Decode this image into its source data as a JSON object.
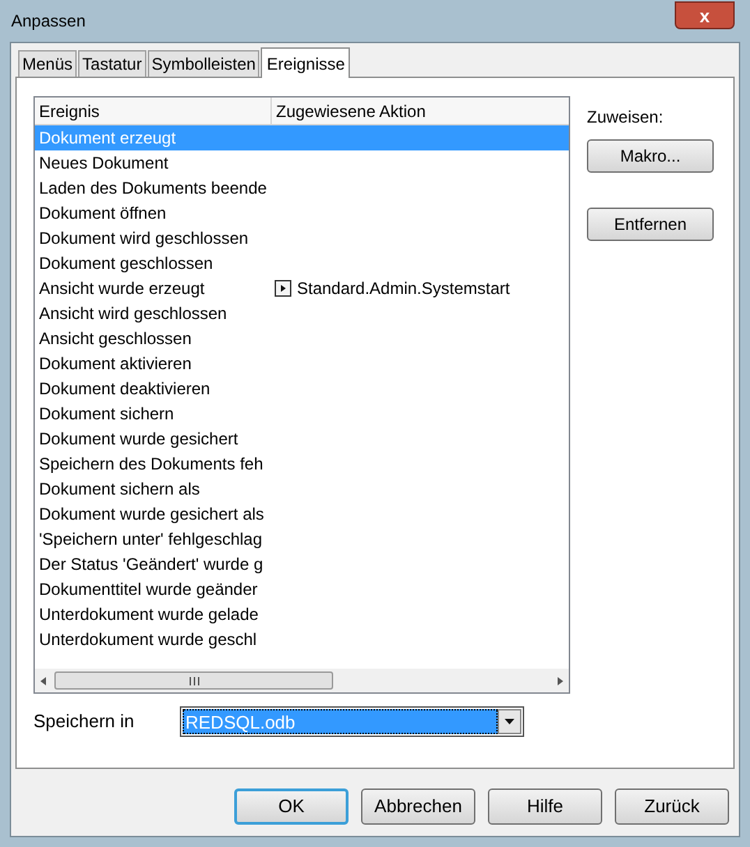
{
  "window": {
    "title": "Anpassen",
    "close_label": "x"
  },
  "tabs": [
    {
      "label": "Menüs",
      "selected": false
    },
    {
      "label": "Tastatur",
      "selected": false
    },
    {
      "label": "Symbolleisten",
      "selected": false
    },
    {
      "label": "Ereignisse",
      "selected": true
    }
  ],
  "table": {
    "columns": [
      "Ereignis",
      "Zugewiesene Aktion"
    ],
    "rows": [
      {
        "event": "Dokument erzeugt",
        "selected": true
      },
      {
        "event": "Neues Dokument",
        "selected": false
      },
      {
        "event": "Laden des Dokuments beende",
        "selected": false
      },
      {
        "event": "Dokument öffnen",
        "selected": false
      },
      {
        "event": "Dokument wird geschlossen",
        "selected": false
      },
      {
        "event": "Dokument geschlossen",
        "selected": false
      },
      {
        "event": "Ansicht wurde erzeugt",
        "action": "Standard.Admin.Systemstart",
        "selected": false
      },
      {
        "event": "Ansicht wird geschlossen",
        "selected": false
      },
      {
        "event": "Ansicht geschlossen",
        "selected": false
      },
      {
        "event": "Dokument aktivieren",
        "selected": false
      },
      {
        "event": "Dokument deaktivieren",
        "selected": false
      },
      {
        "event": "Dokument sichern",
        "selected": false
      },
      {
        "event": "Dokument wurde gesichert",
        "selected": false
      },
      {
        "event": "Speichern des Dokuments feh",
        "selected": false
      },
      {
        "event": "Dokument sichern als",
        "selected": false
      },
      {
        "event": "Dokument wurde gesichert als",
        "selected": false
      },
      {
        "event": "'Speichern unter' fehlgeschlag",
        "selected": false
      },
      {
        "event": "Der Status 'Geändert' wurde g",
        "selected": false
      },
      {
        "event": "Dokumenttitel wurde geänder",
        "selected": false
      },
      {
        "event": "Unterdokument wurde gelade",
        "selected": false
      },
      {
        "event": "Unterdokument wurde geschl",
        "selected": false
      }
    ]
  },
  "assign": {
    "label": "Zuweisen:",
    "buttons": [
      "Makro...",
      "Entfernen"
    ]
  },
  "save_in": {
    "label": "Speichern in",
    "value": "REDSQL.odb"
  },
  "buttons": [
    {
      "label": "OK",
      "default": true
    },
    {
      "label": "Abbrechen",
      "default": false
    },
    {
      "label": "Hilfe",
      "default": false
    },
    {
      "label": "Zurück",
      "default": false
    }
  ]
}
